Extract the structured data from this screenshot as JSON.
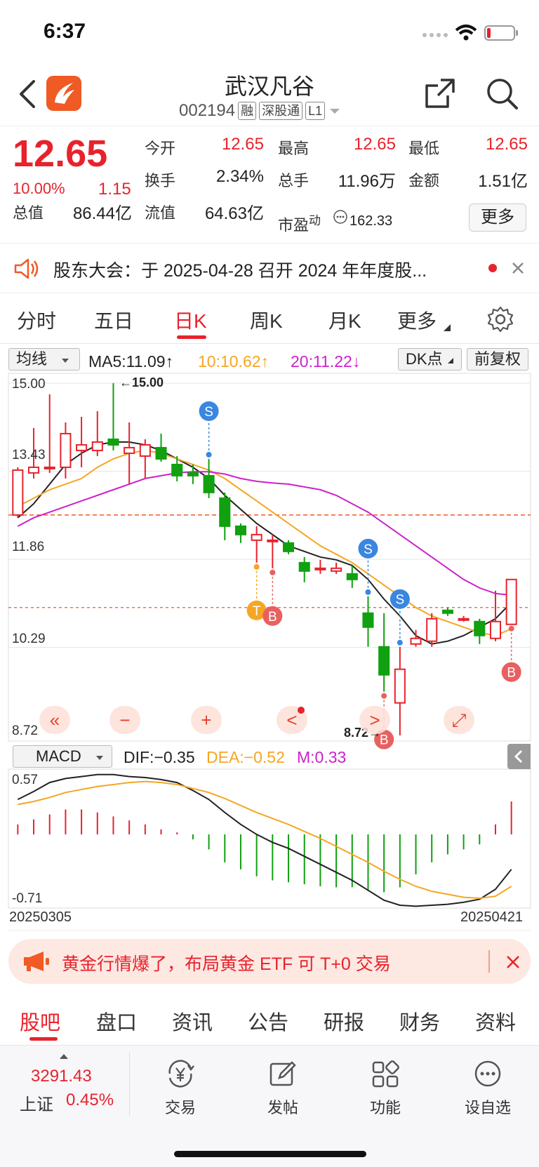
{
  "status_bar": {
    "time": "6:37"
  },
  "header": {
    "stock_name": "武汉凡谷",
    "stock_code": "002194",
    "tags": [
      "融",
      "深股通",
      "L1"
    ]
  },
  "quote": {
    "price": "12.65",
    "change_pct": "10.00%",
    "change_amt": "1.15",
    "fields": [
      {
        "label": "今开",
        "value": "12.65",
        "color": "#e8222c"
      },
      {
        "label": "最高",
        "value": "12.65",
        "color": "#e8222c"
      },
      {
        "label": "最低",
        "value": "12.65",
        "color": "#e8222c"
      },
      {
        "label": "换手",
        "value": "2.34%",
        "color": "#222222"
      },
      {
        "label": "总手",
        "value": "11.96万",
        "color": "#222222"
      },
      {
        "label": "金额",
        "value": "1.51亿",
        "color": "#222222"
      },
      {
        "label": "总值",
        "value": "86.44亿",
        "color": "#222222"
      },
      {
        "label": "流值",
        "value": "64.63亿",
        "color": "#222222"
      }
    ],
    "pe_label": "市盈",
    "pe_sup": "动",
    "pe_value": "162.33",
    "more_label": "更多"
  },
  "notice": {
    "text": "股东大会：于 2025-04-28 召开 2024 年年度股..."
  },
  "chart_tabs": {
    "items": [
      "分时",
      "五日",
      "日K",
      "周K",
      "月K",
      "更多"
    ],
    "active": "日K"
  },
  "ma_bar": {
    "select_label": "均线",
    "ma5": "MA5:11.09↑",
    "ma10": "10:10.62↑",
    "ma20": "20:11.22↓",
    "dk_label": "DK点",
    "fq_label": "前复权"
  },
  "macd_bar": {
    "select_label": "MACD",
    "dif": "DIF:−0.35",
    "dea": "DEA:−0.52",
    "m": "M:0.33"
  },
  "colors": {
    "up": "#e8222c",
    "down": "#10a010",
    "ma5": "#222222",
    "ma10": "#f5a623",
    "ma20": "#cc22cc",
    "accent": "#e8222c"
  },
  "chart_data": [
    {
      "type": "candlestick",
      "y_tick_labels": [
        "15.00",
        "13.43",
        "11.86",
        "10.29",
        "8.72"
      ],
      "ylim": [
        8.72,
        15.0
      ],
      "hline_value": 12.65,
      "hline2_value": 11.0,
      "annotations": {
        "high": "←15.00",
        "low": "8.72→"
      },
      "signals": [
        {
          "type": "S",
          "index": 12
        },
        {
          "type": "T",
          "index": 15
        },
        {
          "type": "B",
          "index": 16
        },
        {
          "type": "S",
          "index": 22
        },
        {
          "type": "B",
          "index": 23
        },
        {
          "type": "S",
          "index": 24
        },
        {
          "type": "B",
          "index": 31
        }
      ],
      "candles": [
        {
          "o": 12.65,
          "c": 13.45,
          "h": 13.5,
          "l": 12.6
        },
        {
          "o": 13.4,
          "c": 13.5,
          "h": 14.2,
          "l": 13.3
        },
        {
          "o": 13.5,
          "c": 13.5,
          "h": 14.8,
          "l": 13.4
        },
        {
          "o": 13.5,
          "c": 14.1,
          "h": 14.3,
          "l": 13.3
        },
        {
          "o": 13.8,
          "c": 13.9,
          "h": 14.4,
          "l": 13.5
        },
        {
          "o": 13.8,
          "c": 13.95,
          "h": 14.5,
          "l": 13.7
        },
        {
          "o": 14.0,
          "c": 13.9,
          "h": 15.0,
          "l": 13.8
        },
        {
          "o": 13.75,
          "c": 13.85,
          "h": 14.3,
          "l": 13.2
        },
        {
          "o": 13.7,
          "c": 13.9,
          "h": 14.0,
          "l": 13.3
        },
        {
          "o": 13.85,
          "c": 13.65,
          "h": 14.1,
          "l": 13.6
        },
        {
          "o": 13.55,
          "c": 13.35,
          "h": 13.7,
          "l": 13.25
        },
        {
          "o": 13.4,
          "c": 13.35,
          "h": 13.55,
          "l": 13.2
        },
        {
          "o": 13.35,
          "c": 13.05,
          "h": 13.65,
          "l": 12.95
        },
        {
          "o": 12.95,
          "c": 12.45,
          "h": 13.05,
          "l": 12.2
        },
        {
          "o": 12.45,
          "c": 12.3,
          "h": 12.5,
          "l": 12.15
        },
        {
          "o": 12.2,
          "c": 12.3,
          "h": 12.45,
          "l": 11.8
        },
        {
          "o": 12.2,
          "c": 12.2,
          "h": 12.3,
          "l": 11.7
        },
        {
          "o": 12.15,
          "c": 12.0,
          "h": 12.2,
          "l": 11.95
        },
        {
          "o": 11.8,
          "c": 11.65,
          "h": 11.9,
          "l": 11.45
        },
        {
          "o": 11.7,
          "c": 11.7,
          "h": 11.85,
          "l": 11.6
        },
        {
          "o": 11.65,
          "c": 11.7,
          "h": 11.8,
          "l": 11.6
        },
        {
          "o": 11.6,
          "c": 11.5,
          "h": 11.75,
          "l": 11.35
        },
        {
          "o": 10.9,
          "c": 10.65,
          "h": 11.2,
          "l": 10.3
        },
        {
          "o": 10.3,
          "c": 9.8,
          "h": 10.9,
          "l": 9.5
        },
        {
          "o": 9.3,
          "c": 9.9,
          "h": 10.3,
          "l": 8.72
        },
        {
          "o": 10.35,
          "c": 10.45,
          "h": 10.6,
          "l": 10.3
        },
        {
          "o": 10.4,
          "c": 10.8,
          "h": 10.9,
          "l": 10.3
        },
        {
          "o": 10.95,
          "c": 10.9,
          "h": 11.0,
          "l": 10.85
        },
        {
          "o": 10.8,
          "c": 10.8,
          "h": 10.85,
          "l": 10.75
        },
        {
          "o": 10.75,
          "c": 10.5,
          "h": 10.8,
          "l": 10.35
        },
        {
          "o": 10.45,
          "c": 10.75,
          "h": 11.3,
          "l": 10.4
        },
        {
          "o": 10.7,
          "c": 11.5,
          "h": 11.5,
          "l": 10.7
        }
      ],
      "ma5": [
        12.6,
        12.85,
        13.2,
        13.55,
        13.75,
        13.9,
        13.95,
        13.95,
        13.9,
        13.8,
        13.65,
        13.5,
        13.3,
        13.0,
        12.75,
        12.5,
        12.3,
        12.1,
        12.0,
        11.9,
        11.85,
        11.75,
        11.5,
        11.15,
        10.85,
        10.5,
        10.35,
        10.4,
        10.5,
        10.65,
        10.8,
        11.09
      ],
      "ma10": [
        12.8,
        12.95,
        13.1,
        13.2,
        13.3,
        13.5,
        13.65,
        13.75,
        13.8,
        13.75,
        13.65,
        13.55,
        13.45,
        13.3,
        13.1,
        12.9,
        12.7,
        12.5,
        12.3,
        12.1,
        11.95,
        11.8,
        11.6,
        11.4,
        11.2,
        11.0,
        10.85,
        10.75,
        10.65,
        10.55,
        10.5,
        10.62
      ],
      "ma20": [
        12.45,
        12.6,
        12.7,
        12.8,
        12.9,
        13.0,
        13.1,
        13.2,
        13.3,
        13.35,
        13.4,
        13.42,
        13.42,
        13.38,
        13.3,
        13.25,
        13.22,
        13.2,
        13.15,
        13.1,
        13.0,
        12.85,
        12.7,
        12.5,
        12.3,
        12.1,
        11.9,
        11.7,
        11.5,
        11.35,
        11.25,
        11.22
      ]
    },
    {
      "type": "macd",
      "y_tick_labels": [
        "0.57",
        "-0.71"
      ],
      "ylim": [
        -0.71,
        0.57
      ],
      "x_tick_labels": [
        "20250305",
        "20250421"
      ],
      "dif": [
        0.35,
        0.43,
        0.52,
        0.56,
        0.58,
        0.6,
        0.6,
        0.58,
        0.57,
        0.55,
        0.52,
        0.44,
        0.35,
        0.22,
        0.1,
        0.0,
        -0.08,
        -0.14,
        -0.22,
        -0.3,
        -0.38,
        -0.46,
        -0.56,
        -0.66,
        -0.71,
        -0.72,
        -0.71,
        -0.7,
        -0.68,
        -0.65,
        -0.55,
        -0.35
      ],
      "dea": [
        0.3,
        0.33,
        0.37,
        0.42,
        0.45,
        0.48,
        0.5,
        0.52,
        0.53,
        0.52,
        0.5,
        0.46,
        0.42,
        0.36,
        0.29,
        0.22,
        0.16,
        0.1,
        0.03,
        -0.04,
        -0.12,
        -0.2,
        -0.28,
        -0.37,
        -0.45,
        -0.52,
        -0.57,
        -0.6,
        -0.63,
        -0.64,
        -0.62,
        -0.52
      ],
      "m": [
        0.1,
        0.15,
        0.2,
        0.25,
        0.25,
        0.22,
        0.18,
        0.14,
        0.1,
        0.05,
        0.02,
        -0.05,
        -0.15,
        -0.28,
        -0.35,
        -0.42,
        -0.46,
        -0.48,
        -0.5,
        -0.52,
        -0.53,
        -0.53,
        -0.56,
        -0.58,
        -0.53,
        -0.4,
        -0.28,
        -0.2,
        -0.15,
        -0.1,
        0.1,
        0.33
      ]
    }
  ],
  "chart_controls": [
    "«",
    "−",
    "+",
    "<",
    ">",
    "⤢"
  ],
  "banner": {
    "text": "黄金行情爆了，布局黄金 ETF 可 T+0 交易"
  },
  "sub_tabs": {
    "items": [
      "股吧",
      "盘口",
      "资讯",
      "公告",
      "研报",
      "财务",
      "资料"
    ],
    "active": "股吧"
  },
  "footer": {
    "index_value": "3291.43",
    "index_name": "上证",
    "index_change": "0.45%",
    "actions": [
      {
        "label": "交易",
        "icon": "yen-exchange-icon"
      },
      {
        "label": "发帖",
        "icon": "edit-icon"
      },
      {
        "label": "功能",
        "icon": "grid-icon"
      },
      {
        "label": "设自选",
        "icon": "more-circle-icon"
      }
    ]
  }
}
